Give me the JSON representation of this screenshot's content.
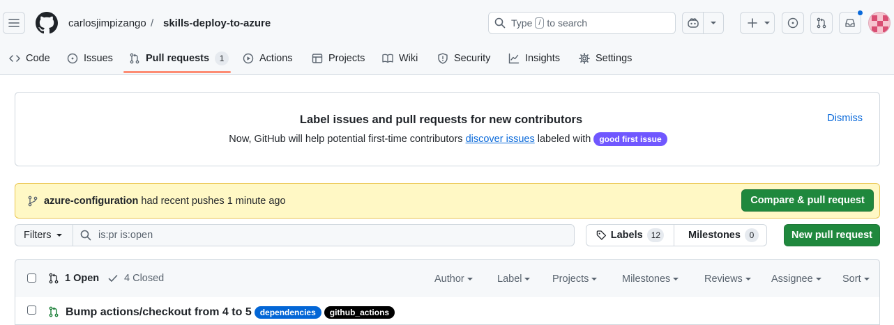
{
  "header": {
    "owner": "carlosjimpizango",
    "separator": "/",
    "repo": "skills-deploy-to-azure",
    "search_pre": "Type",
    "search_key": "/",
    "search_post": "to search"
  },
  "tabs": [
    {
      "label": "Code",
      "icon": "code-icon"
    },
    {
      "label": "Issues",
      "icon": "issue-opened-icon"
    },
    {
      "label": "Pull requests",
      "icon": "git-pull-request-icon",
      "count": "1",
      "active": true
    },
    {
      "label": "Actions",
      "icon": "play-icon"
    },
    {
      "label": "Projects",
      "icon": "table-icon"
    },
    {
      "label": "Wiki",
      "icon": "book-icon"
    },
    {
      "label": "Security",
      "icon": "shield-icon"
    },
    {
      "label": "Insights",
      "icon": "graph-icon"
    },
    {
      "label": "Settings",
      "icon": "gear-icon"
    }
  ],
  "banner": {
    "title": "Label issues and pull requests for new contributors",
    "text_pre": "Now, GitHub will help potential first-time contributors",
    "link": "discover issues",
    "text_post": "labeled with",
    "label": "good first issue",
    "dismiss": "Dismiss"
  },
  "push": {
    "branch": "azure-configuration",
    "text": "had recent pushes 1 minute ago",
    "button": "Compare & pull request"
  },
  "filterbar": {
    "filters": "Filters",
    "query": "is:pr is:open",
    "labels": "Labels",
    "labels_count": "12",
    "milestones": "Milestones",
    "milestones_count": "0",
    "new_pr": "New pull request"
  },
  "list": {
    "open": "1 Open",
    "closed": "4 Closed",
    "filters": [
      "Author",
      "Label",
      "Projects",
      "Milestones",
      "Reviews",
      "Assignee",
      "Sort"
    ],
    "rows": [
      {
        "title": "Bump actions/checkout from 4 to 5",
        "labels": [
          {
            "name": "dependencies",
            "color": "#0366d6",
            "text": "#ffffff"
          },
          {
            "name": "github_actions",
            "color": "#000000",
            "text": "#ffffff"
          }
        ]
      }
    ]
  },
  "colors": {
    "accent": "#0969da",
    "green": "#1f883d",
    "tab_underline": "#fd8c73",
    "good_first_issue": "#7057ff"
  }
}
